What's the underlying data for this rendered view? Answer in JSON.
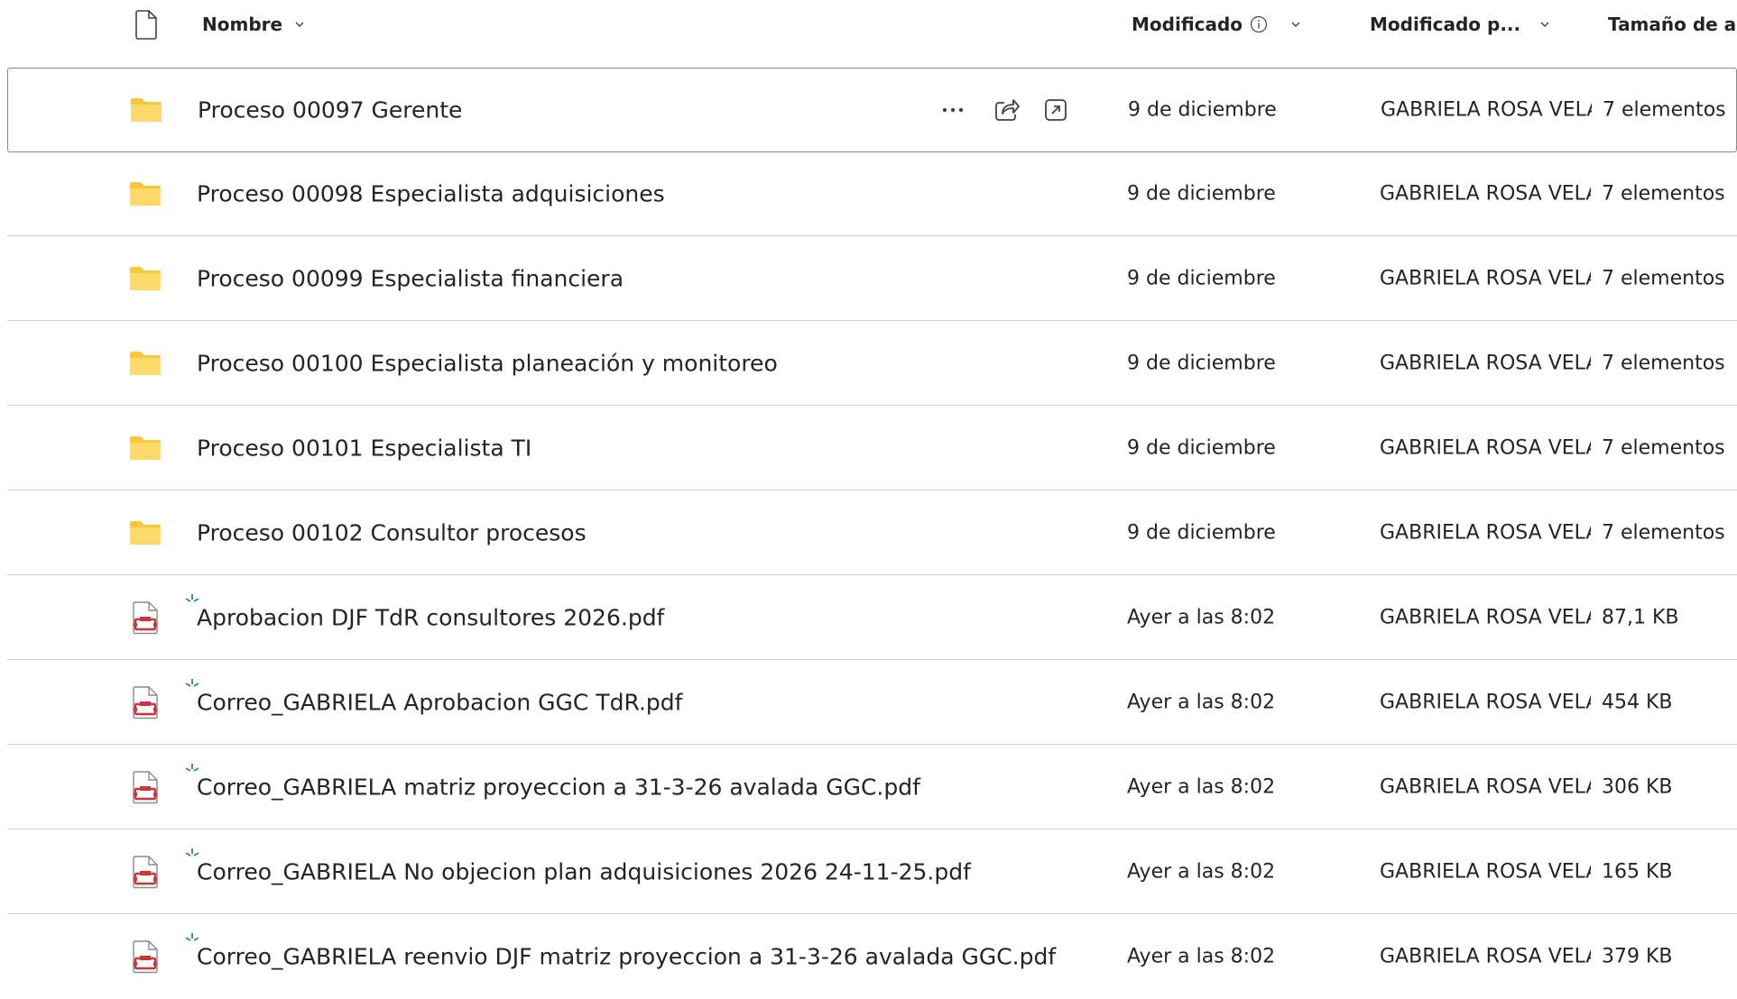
{
  "columns": {
    "name": "Nombre",
    "modified": "Modificado",
    "modified_by": "Modificado p...",
    "size": "Tamaño de a"
  },
  "rows": [
    {
      "type": "folder",
      "name": "Proceso 00097 Gerente",
      "modified": "9 de diciembre",
      "modified_by": "GABRIELA ROSA VELASCO",
      "size": "7 elementos",
      "selected": true
    },
    {
      "type": "folder",
      "name": "Proceso 00098 Especialista adquisiciones",
      "modified": "9 de diciembre",
      "modified_by": "GABRIELA ROSA VELASCO",
      "size": "7 elementos"
    },
    {
      "type": "folder",
      "name": "Proceso 00099 Especialista financiera",
      "modified": "9 de diciembre",
      "modified_by": "GABRIELA ROSA VELASCO",
      "size": "7 elementos"
    },
    {
      "type": "folder",
      "name": "Proceso 00100 Especialista planeación y monitoreo",
      "modified": "9 de diciembre",
      "modified_by": "GABRIELA ROSA VELASCO",
      "size": "7 elementos"
    },
    {
      "type": "folder",
      "name": "Proceso 00101 Especialista TI",
      "modified": "9 de diciembre",
      "modified_by": "GABRIELA ROSA VELASCO",
      "size": "7 elementos"
    },
    {
      "type": "folder",
      "name": "Proceso 00102 Consultor procesos",
      "modified": "9 de diciembre",
      "modified_by": "GABRIELA ROSA VELASCO",
      "size": "7 elementos"
    },
    {
      "type": "pdf",
      "name": "Aprobacion DJF TdR consultores 2026.pdf",
      "modified": "Ayer a las 8:02",
      "modified_by": "GABRIELA ROSA VELASCO",
      "size": "87,1 KB",
      "new": true
    },
    {
      "type": "pdf",
      "name": "Correo_GABRIELA Aprobacion GGC TdR.pdf",
      "modified": "Ayer a las 8:02",
      "modified_by": "GABRIELA ROSA VELASCO",
      "size": "454 KB",
      "new": true
    },
    {
      "type": "pdf",
      "name": "Correo_GABRIELA matriz proyeccion a 31-3-26 avalada GGC.pdf",
      "modified": "Ayer a las 8:02",
      "modified_by": "GABRIELA ROSA VELASCO",
      "size": "306 KB",
      "new": true
    },
    {
      "type": "pdf",
      "name": "Correo_GABRIELA No objecion plan adquisiciones 2026 24-11-25.pdf",
      "modified": "Ayer a las 8:02",
      "modified_by": "GABRIELA ROSA VELASCO",
      "size": "165 KB",
      "new": true
    },
    {
      "type": "pdf",
      "name": "Correo_GABRIELA reenvio DJF matriz proyeccion a 31-3-26 avalada GGC.pdf",
      "modified": "Ayer a las 8:02",
      "modified_by": "GABRIELA ROSA VELASCO",
      "size": "379 KB",
      "new": true
    }
  ],
  "colors": {
    "folder": "#f8c83c",
    "pdf": "#d13438",
    "new_marker": "#0f6cbd",
    "divider": "#d1d1d1"
  }
}
